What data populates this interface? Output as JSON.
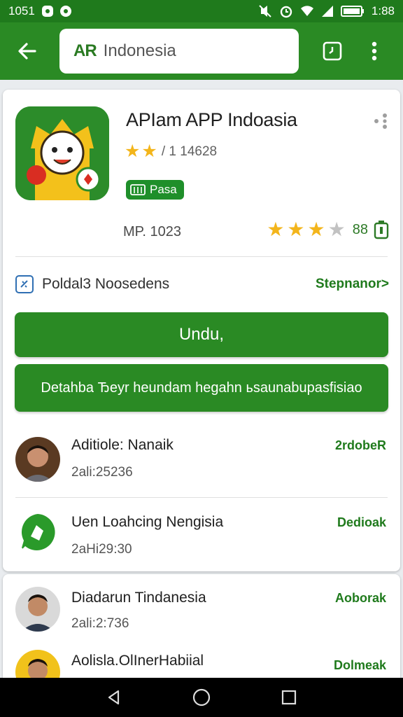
{
  "status_bar": {
    "time_left": "1051",
    "time_right": "1:88"
  },
  "search": {
    "prefix": "AR",
    "query": "Indonesia"
  },
  "app": {
    "title": "APIam APP Indoasia",
    "rating_text": "/ 1 14628",
    "badge_label": "Pasa",
    "meta_left": "MP. 1023",
    "meta_count": "88",
    "developer_label": "Poldal3 Noosedens",
    "developer_link": "Stepnanor>",
    "install_label": "Undu,",
    "secondary_label": "Detahba Ђeyr heundam hegahn ьsaunabupasfisiao"
  },
  "list": [
    {
      "title": "Aditiole: Nanaik",
      "subtitle": "2ali:25236",
      "action": "2rdobeR"
    },
    {
      "title": "Uen Loahcing Nengisia",
      "subtitle": "2aHi29:30",
      "action": "Dedioak"
    },
    {
      "title": "Diadarun Tindanesia",
      "subtitle": "2ali:2:736",
      "action": "Aoborak"
    },
    {
      "title": "Aolisla.OlInerHabiial",
      "subtitle": "",
      "action": "Dolmeak"
    }
  ],
  "colors": {
    "primary": "#2a8a24",
    "star": "#f3b51b",
    "accent_text": "#1f7a1c"
  }
}
